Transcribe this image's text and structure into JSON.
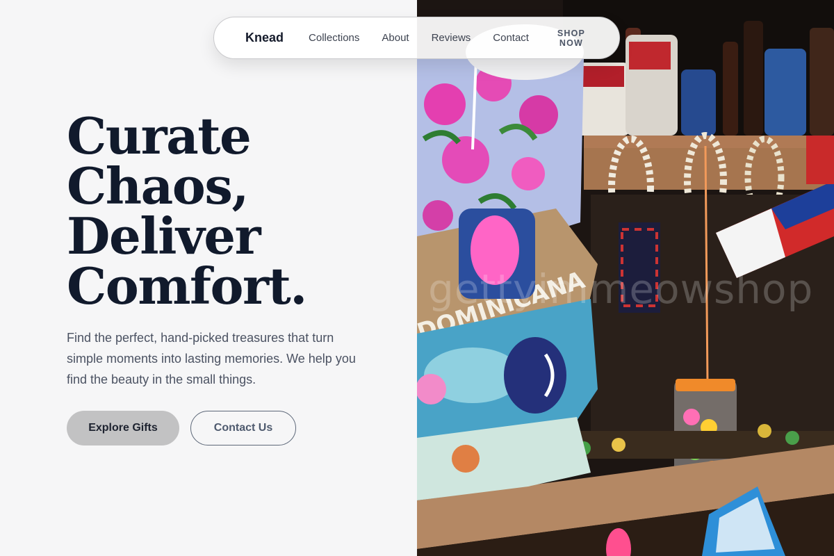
{
  "nav": {
    "brand": "Knead",
    "links": [
      "Collections",
      "About",
      "Reviews",
      "Contact"
    ],
    "cta": "SHOP NOW"
  },
  "hero": {
    "title_lines": [
      "Curate",
      "Chaos,",
      "Deliver",
      "Comfort."
    ],
    "description": "Find the perfect, hand-picked treasures that turn simple moments into lasting memories. We help you find the beauty in the small things.",
    "primary_button": "Explore Gifts",
    "secondary_button": "Contact Us"
  },
  "photo": {
    "alt": "Market stall with colorful Dominican souvenirs",
    "watermark": "gettyimmeowshop",
    "bag_text": "DOMINICANA"
  },
  "colors": {
    "background": "#f6f6f7",
    "heading": "#111a2c",
    "body_text": "#4b5262",
    "primary_button_bg": "#c2c2c3",
    "secondary_button_border": "#5c6778"
  }
}
